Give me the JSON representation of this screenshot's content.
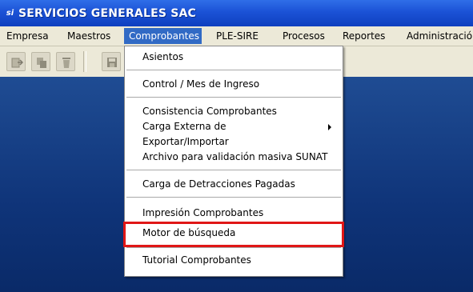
{
  "window": {
    "title": "SERVICIOS GENERALES SAC",
    "app_icon_text": "si"
  },
  "menubar": {
    "items": [
      "Empresa",
      "Maestros",
      "Comprobantes",
      "PLE-SIRE",
      "Procesos",
      "Reportes",
      "Administración"
    ],
    "active": "Comprobantes"
  },
  "toolbar": {
    "buttons": [
      "open-icon",
      "copy-icon",
      "delete-icon",
      "save-icon"
    ]
  },
  "dropdown": {
    "items": [
      "Asientos",
      "Control / Mes de Ingreso",
      "Consistencia Comprobantes",
      "Carga Externa de",
      "Exportar/Importar",
      "Archivo para validación masiva SUNAT",
      "Carga de Detracciones Pagadas",
      "Impresión Comprobantes",
      "Motor de búsqueda",
      "Tutorial Comprobantes"
    ],
    "highlighted": "Motor de búsqueda"
  },
  "colors": {
    "title_bar": "#1b52d6",
    "menu_active": "#316ac5",
    "highlight_border": "#e01616",
    "workspace": "#163f86"
  }
}
